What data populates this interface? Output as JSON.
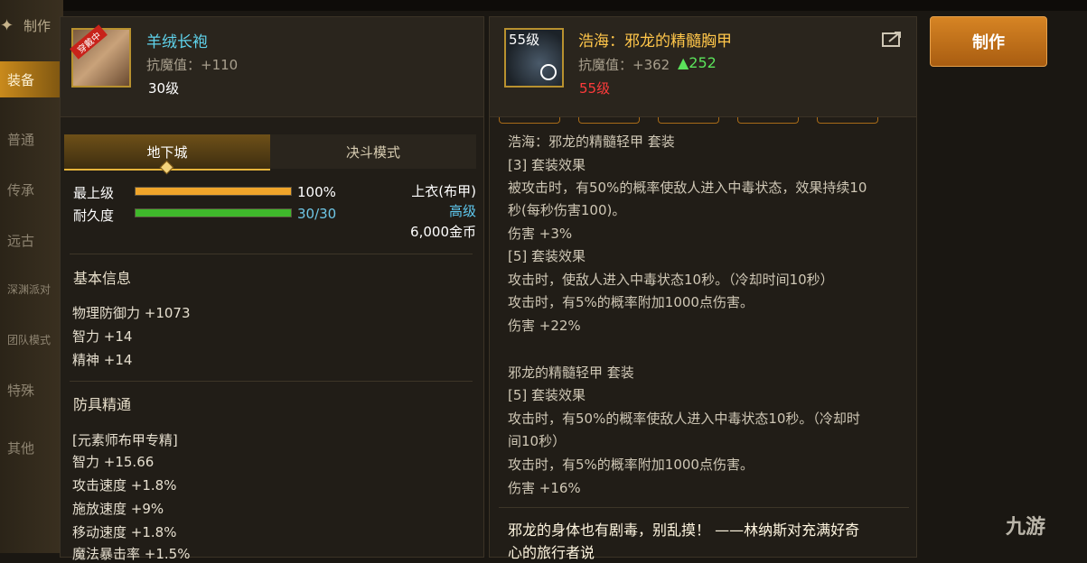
{
  "top": {
    "tab_label": "制作"
  },
  "sidebar": {
    "items": [
      {
        "label": "装备",
        "active": true
      },
      {
        "label": "普通"
      },
      {
        "label": "传承"
      },
      {
        "label": "远古"
      },
      {
        "label": "深渊派对"
      },
      {
        "label": "团队模式"
      },
      {
        "label": "特殊"
      },
      {
        "label": "其他"
      }
    ]
  },
  "left": {
    "item": {
      "name": "羊绒长袍",
      "badge": "穿戴中",
      "resist": "抗魔值：+110",
      "level": "30级"
    },
    "tabs": [
      "地下城",
      "决斗模式"
    ],
    "bars": [
      {
        "label": "最上级",
        "value_text": "100%",
        "fill": 1.0,
        "color": "#f0a52a"
      },
      {
        "label": "耐久度",
        "value_text": "30/30",
        "fill": 1.0,
        "color": "#3fb82b"
      }
    ],
    "info": {
      "slot": "上衣(布甲)",
      "grade": "高级",
      "price": "6,000金币"
    },
    "basic_title": "基本信息",
    "basic": [
      "物理防御力 +1073",
      "智力 +14",
      "精神 +14"
    ],
    "mastery_title": "防具精通",
    "mastery": [
      "[元素师布甲专精]",
      "智力 +15.66",
      "攻击速度 +1.8%",
      "施放速度 +9%",
      "移动速度 +1.8%",
      "魔法暴击率 +1.5%"
    ]
  },
  "right": {
    "item": {
      "name": "浩海：邪龙的精髓胸甲",
      "level_badge": "55级",
      "resist": "抗魔值：+362",
      "delta": "▲252",
      "level": "55级"
    },
    "lines": [
      "浩海：邪龙的精髓轻甲 套装",
      "[3] 套装效果",
      "被攻击时，有50%的概率使敌人进入中毒状态，效果持续10",
      "秒(每秒伤害100)。",
      "伤害 +3%",
      "[5] 套装效果",
      "攻击时，使敌人进入中毒状态10秒。（冷却时间10秒）",
      "攻击时，有5%的概率附加1000点伤害。",
      "伤害 +22%",
      "",
      "邪龙的精髓轻甲 套装",
      "[5] 套装效果",
      "攻击时，有50%的概率使敌人进入中毒状态10秒。（冷却时",
      "间10秒）",
      "攻击时，有5%的概率附加1000点伤害。",
      "伤害 +16%"
    ],
    "flavor": "邪龙的身体也有剧毒，别乱摸！ ——林纳斯对充满好奇",
    "flavor2": "心的旅行者说"
  },
  "make_button": "制作",
  "watermark": "九游",
  "colors": {
    "accent": "#e6b43a",
    "cyan": "#5fd3ec",
    "red": "#ff3b3b",
    "green": "#5be35b",
    "grade": "#5fc8ef"
  }
}
